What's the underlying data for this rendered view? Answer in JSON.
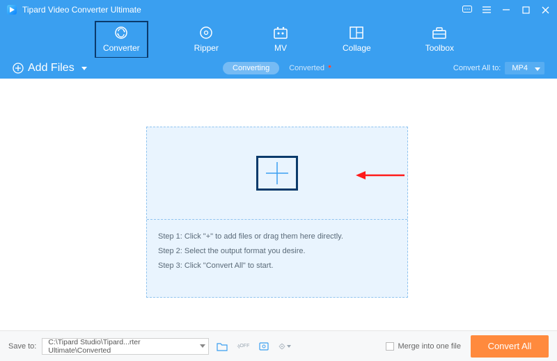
{
  "titlebar": {
    "appName": "Tipard Video Converter Ultimate"
  },
  "nav": {
    "converter": "Converter",
    "ripper": "Ripper",
    "mv": "MV",
    "collage": "Collage",
    "toolbox": "Toolbox"
  },
  "subbar": {
    "addFiles": "Add Files",
    "tabConverting": "Converting",
    "tabConverted": "Converted",
    "convertAllTo": "Convert All to:",
    "format": "MP4"
  },
  "dropzone": {
    "step1": "Step 1: Click \"+\" to add files or drag them here directly.",
    "step2": "Step 2: Select the output format you desire.",
    "step3": "Step 3: Click \"Convert All\" to start."
  },
  "footer": {
    "saveTo": "Save to:",
    "path": "C:\\Tipard Studio\\Tipard...rter Ultimate\\Converted",
    "merge": "Merge into one file",
    "convertAll": "Convert All"
  }
}
